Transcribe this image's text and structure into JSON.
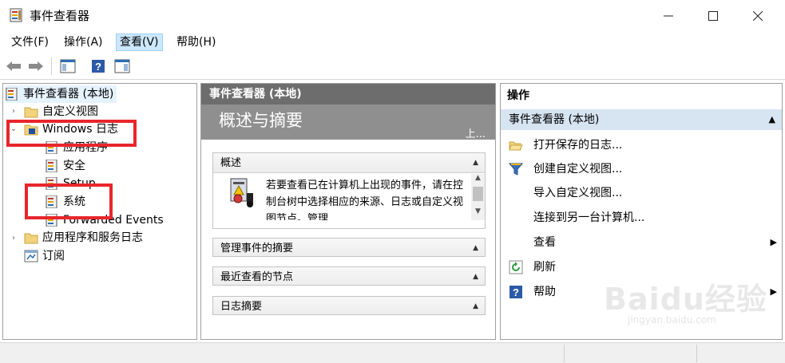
{
  "window": {
    "title": "事件查看器"
  },
  "menu": [
    "文件(F)",
    "操作(A)",
    "查看(V)",
    "帮助(H)"
  ],
  "tree": {
    "root": "事件查看器 (本地)",
    "custom_views": "自定义视图",
    "windows_logs": "Windows 日志",
    "application": "应用程序",
    "security": "安全",
    "setup": "Setup",
    "system": "系统",
    "forwarded": "Forwarded Events",
    "app_service_logs": "应用程序和服务日志",
    "subscriptions": "订阅"
  },
  "middle": {
    "header": "事件查看器 (本地)",
    "banner_title": "概述与摘要",
    "banner_more": "上...",
    "sections": {
      "overview": "概述",
      "overview_text": "若要查看已在计算机上出现的事件，请在控制台树中选择相应的来源、日志或自定义视图节点。管理",
      "admin_events": "管理事件的摘要",
      "recent_nodes": "最近查看的节点",
      "log_summary": "日志摘要"
    }
  },
  "actions": {
    "header": "操作",
    "section": "事件查看器 (本地)",
    "items": [
      "打开保存的日志...",
      "创建自定义视图...",
      "导入自定义视图...",
      "连接到另一台计算机...",
      "查看",
      "刷新",
      "帮助"
    ]
  },
  "watermark": {
    "brand": "Baidu经验",
    "url": "jingyan.baidu.com"
  },
  "colors": {
    "highlight_box": "#e8262c",
    "mid_header": "#6d6d6d",
    "action_section": "#d7e4f2"
  }
}
